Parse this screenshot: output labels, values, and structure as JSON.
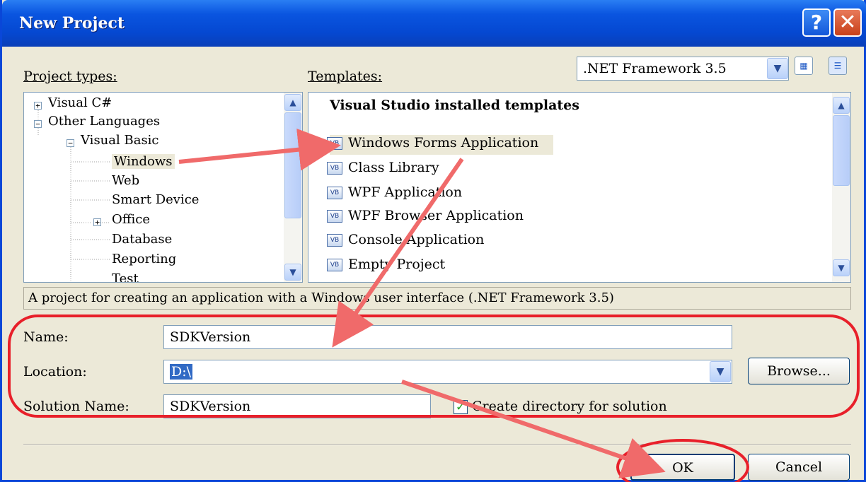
{
  "window": {
    "title": "New Project",
    "help_glyph": "?",
    "close_glyph": "✕"
  },
  "project_types": {
    "label": "Project types:",
    "items": [
      {
        "label": "Visual C#",
        "expander": "+"
      },
      {
        "label": "Other Languages",
        "expander": "−"
      },
      {
        "label": "Visual Basic",
        "expander": "−"
      },
      {
        "label": "Windows"
      },
      {
        "label": "Web"
      },
      {
        "label": "Smart Device"
      },
      {
        "label": "Office",
        "expander": "+"
      },
      {
        "label": "Database"
      },
      {
        "label": "Reporting"
      },
      {
        "label": "Test"
      }
    ]
  },
  "templates": {
    "label": "Templates:",
    "framework": ".NET Framework 3.5",
    "group_header": "Visual Studio installed templates",
    "items": [
      {
        "label": "Windows Forms Application",
        "icon": "VB"
      },
      {
        "label": "Class Library",
        "icon": "VB"
      },
      {
        "label": "WPF Application",
        "icon": "VB"
      },
      {
        "label": "WPF Browser Application",
        "icon": "VB"
      },
      {
        "label": "Console Application",
        "icon": "VB"
      },
      {
        "label": "Empty Project",
        "icon": "VB"
      }
    ]
  },
  "description": "A project for creating an application with a Windows user interface (.NET Framework 3.5)",
  "form": {
    "name_label": "Name:",
    "name_value": "SDKVersion",
    "location_label": "Location:",
    "location_value": "D:\\",
    "browse_label": "Browse...",
    "solution_label": "Solution Name:",
    "solution_value": "SDKVersion",
    "create_dir_label": "Create directory for solution",
    "create_dir_checked": true
  },
  "buttons": {
    "ok": "OK",
    "cancel": "Cancel"
  },
  "glyphs": {
    "scroll_up": "▲",
    "scroll_down": "▼",
    "dropdown": "▼",
    "check": "✓",
    "large_icons_view": "▦",
    "small_icons_view": "☰"
  },
  "annotation_color": "#e8202a",
  "arrow_color": "#f06a6a"
}
